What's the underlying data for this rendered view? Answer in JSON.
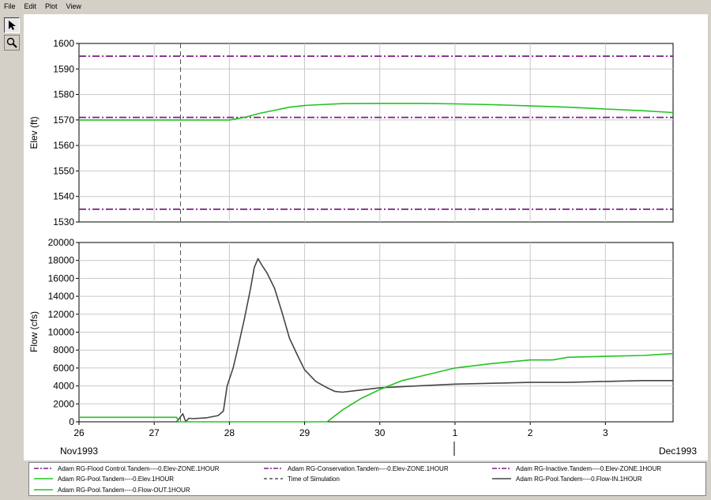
{
  "menu": [
    "File",
    "Edit",
    "Plot",
    "View"
  ],
  "toolbar": [
    {
      "name": "pointer-icon",
      "active": true
    },
    {
      "name": "zoom-icon",
      "active": false
    }
  ],
  "colors": {
    "zone": "#7b1f86",
    "green": "#22c322",
    "flow_in": "#454545",
    "time_line": "#555555",
    "grid": "#c8c8c8"
  },
  "x_axis": {
    "ticks": [
      "26",
      "27",
      "28",
      "29",
      "30",
      "1",
      "2",
      "3"
    ],
    "left_date": "Nov1993",
    "right_date": "Dec1993"
  },
  "chart_data": [
    {
      "type": "line",
      "ylabel": "Elev (ft)",
      "ylim": [
        1530,
        1600
      ],
      "xlim_days": [
        26,
        33.9
      ],
      "yticks": [
        "1530",
        "1540",
        "1550",
        "1560",
        "1570",
        "1580",
        "1590",
        "1600"
      ],
      "series": [
        {
          "name": "Adam RG-Flood Control.Tandem----0.Elev-ZONE.1HOUR",
          "style": "dash-dot",
          "color": "#7b1f86",
          "x": [
            26,
            33.9
          ],
          "y": [
            1595,
            1595
          ]
        },
        {
          "name": "Adam RG-Conservation.Tandem----0.Elev-ZONE.1HOUR",
          "style": "dash-dot",
          "color": "#7b1f86",
          "x": [
            26,
            33.9
          ],
          "y": [
            1571,
            1571
          ]
        },
        {
          "name": "Adam RG-Inactive.Tandem----0.Elev-ZONE.1HOUR",
          "style": "dash-dot",
          "color": "#7b1f86",
          "x": [
            26,
            33.9
          ],
          "y": [
            1535,
            1535
          ]
        },
        {
          "name": "Adam RG-Pool.Tandem----0.Elev.1HOUR",
          "style": "solid",
          "color": "#22c322",
          "x": [
            26,
            27.3,
            28.0,
            28.2,
            28.4,
            28.6,
            28.8,
            29.0,
            29.2,
            29.5,
            30.0,
            30.6,
            31.0,
            31.5,
            32.0,
            32.5,
            33.0,
            33.5,
            33.9
          ],
          "y": [
            1570,
            1570,
            1570,
            1571,
            1572.6,
            1573.8,
            1575.0,
            1575.7,
            1576.0,
            1576.4,
            1576.5,
            1576.5,
            1576.3,
            1576.0,
            1575.5,
            1575.0,
            1574.3,
            1573.6,
            1572.9
          ]
        }
      ]
    },
    {
      "type": "line",
      "ylabel": "Flow (cfs)",
      "ylim": [
        0,
        20000
      ],
      "xlim_days": [
        26,
        33.9
      ],
      "yticks": [
        "0",
        "2000",
        "4000",
        "6000",
        "8000",
        "10000",
        "12000",
        "14000",
        "16000",
        "18000",
        "20000"
      ],
      "series": [
        {
          "name": "Adam RG-Pool.Tandem----0.Flow-IN.1HOUR",
          "style": "solid",
          "color": "#454545",
          "x": [
            27.3,
            27.38,
            27.42,
            27.46,
            27.52,
            27.7,
            27.85,
            27.92,
            27.97,
            28.05,
            28.12,
            28.2,
            28.28,
            28.33,
            28.38,
            28.43,
            28.5,
            28.6,
            28.7,
            28.8,
            28.9,
            29.0,
            29.15,
            29.3,
            29.4,
            29.5,
            29.7,
            30.0,
            30.5,
            31.0,
            31.5,
            32.0,
            32.5,
            33.0,
            33.5,
            33.9
          ],
          "y": [
            0,
            900,
            0,
            400,
            350,
            450,
            700,
            1200,
            4000,
            6000,
            8500,
            11500,
            14800,
            17200,
            18200,
            17500,
            16600,
            14900,
            12200,
            9300,
            7500,
            5800,
            4500,
            3800,
            3400,
            3300,
            3500,
            3800,
            4000,
            4200,
            4300,
            4400,
            4400,
            4500,
            4600,
            4600
          ]
        },
        {
          "name": "Adam RG-Pool.Tandem----0.Flow-OUT.1HOUR",
          "style": "solid",
          "color": "#22c322",
          "x": [
            26,
            27.3,
            27.32,
            29.3,
            29.5,
            29.75,
            30.0,
            30.3,
            30.6,
            31.0,
            31.5,
            32.0,
            32.3,
            32.5,
            33.0,
            33.5,
            33.9
          ],
          "y": [
            500,
            500,
            0,
            0,
            1300,
            2600,
            3600,
            4600,
            5200,
            6000,
            6500,
            6900,
            6900,
            7200,
            7300,
            7400,
            7600
          ]
        }
      ]
    }
  ],
  "time_of_simulation_day": 27.35,
  "legend": [
    {
      "label": "Adam RG-Flood Control.Tandem----0.Elev-ZONE.1HOUR",
      "style": "dash-dot",
      "color": "#7b1f86"
    },
    {
      "label": "Adam RG-Conservation.Tandem----0.Elev-ZONE.1HOUR",
      "style": "dash-dot",
      "color": "#7b1f86"
    },
    {
      "label": "Adam RG-Inactive.Tandem----0.Elev-ZONE.1HOUR",
      "style": "dash-dot",
      "color": "#7b1f86"
    },
    {
      "label": "Adam RG-Pool.Tandem----0.Elev.1HOUR",
      "style": "solid",
      "color": "#22c322"
    },
    {
      "label": "Time of Simulation",
      "style": "dashed",
      "color": "#555555"
    },
    {
      "label": "Adam RG-Pool.Tandem----0.Flow-IN.1HOUR",
      "style": "solid",
      "color": "#454545"
    },
    {
      "label": "Adam RG-Pool.Tandem----0.Flow-OUT.1HOUR",
      "style": "solid",
      "color": "#22c322"
    }
  ]
}
